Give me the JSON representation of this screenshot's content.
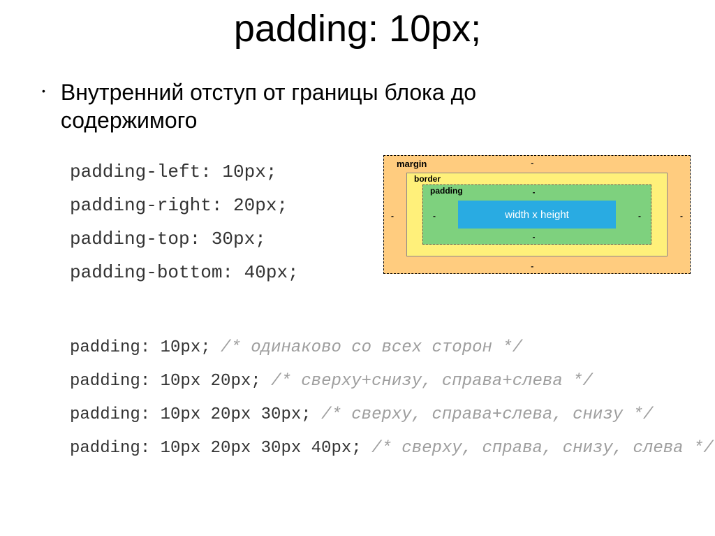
{
  "title": "padding: 10px;",
  "bullet": "Внутренний отступ от границы блока до содержимого",
  "codeLines": {
    "l1": "padding-left: 10px;",
    "l2": "padding-right: 20px;",
    "l3": "padding-top: 30px;",
    "l4": "padding-bottom: 40px;"
  },
  "boxModel": {
    "margin": "margin",
    "border": "border",
    "padding": "padding",
    "content": "width x height",
    "dash": "-"
  },
  "examples": {
    "e1": {
      "code": "padding: 10px;",
      "comment": "/* одинаково со всех сторон */"
    },
    "e2": {
      "code": "padding: 10px 20px;",
      "comment": "/* сверху+снизу, справа+слева */"
    },
    "e3": {
      "code": "padding: 10px 20px 30px;",
      "comment": "/* сверху, справа+слева, снизу */"
    },
    "e4": {
      "code": "padding: 10px 20px 30px 40px;",
      "comment": "/* сверху, справа, снизу, слева */"
    }
  }
}
